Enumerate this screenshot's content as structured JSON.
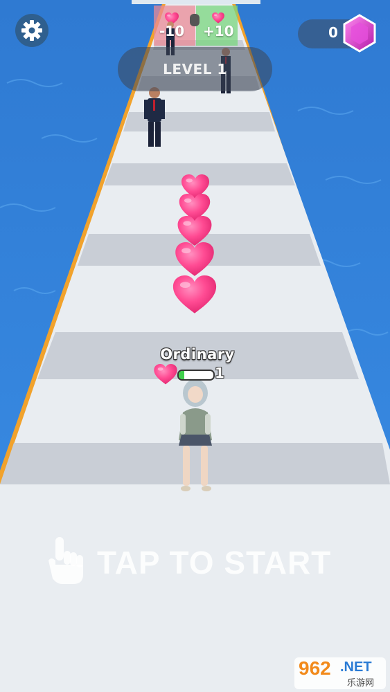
{
  "hud": {
    "gem_count": "0",
    "level_label": "LEVEL 1"
  },
  "gates": {
    "left_label": "-10",
    "right_label": "+10"
  },
  "player": {
    "status_label": "Ordinary",
    "love_value": "1",
    "love_fill_fraction": 0.15
  },
  "prompt": {
    "tap_to_start": "TAP TO START"
  },
  "watermark": {
    "logo_number": "962",
    "logo_suffix": ".NET",
    "logo_sub": "乐游网"
  },
  "icons": [
    "gear-icon",
    "gem-icon",
    "heart-icon",
    "pointing-hand-icon"
  ],
  "colors": {
    "water": "#2f7fd6",
    "track": "#e9edf1",
    "track_stripe": "#c9ced6",
    "track_edge": "#f1a22c",
    "heart": "#ff3f8e",
    "gem": "#e33ad6",
    "left_gate": "#e98a96",
    "right_gate": "#78d57e",
    "love_fill": "#3fcf4b"
  }
}
